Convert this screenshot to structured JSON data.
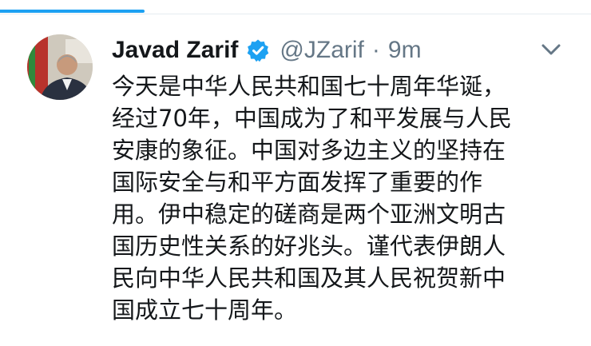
{
  "tweet": {
    "author": {
      "display_name": "Javad Zarif",
      "handle": "@JZarif",
      "verified": true
    },
    "separator": "·",
    "timestamp": "9m",
    "text_lines": [
      "今天是中华人民共和国七十周年华诞，",
      "经过70年，中国成为了和平发展与人民",
      "安康的象征。中国对多边主义的坚持在",
      "国际安全与和平方面发挥了重要的作",
      "用。伊中稳定的磋商是两个亚洲文明古",
      "国历史性关系的好兆头。谨代表伊朗人",
      "民向中华人民共和国及其人民祝贺新中",
      "国成立七十周年。"
    ]
  },
  "icons": {
    "verified": "verified-badge-icon",
    "more": "chevron-down-icon"
  },
  "colors": {
    "accent": "#1da1f2",
    "text_primary": "#14171a",
    "text_secondary": "#657786"
  }
}
